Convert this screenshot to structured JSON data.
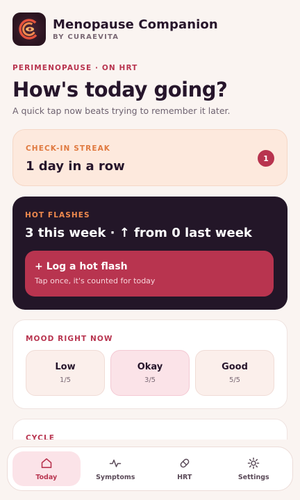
{
  "app": {
    "title": "Menopause Companion",
    "subtitle": "BY CURAEVITA"
  },
  "context": {
    "label": "PERIMENOPAUSE · ON HRT"
  },
  "greeting": {
    "title": "How's today going?",
    "subtitle": "A quick tap now beats trying to remember it later."
  },
  "streak": {
    "label": "CHECK-IN STREAK",
    "value": "1 day in a row",
    "badge": "1"
  },
  "hot_flashes": {
    "label": "HOT FLASHES",
    "summary": "3 this week · ↑ from 0 last week",
    "button_label": "+ Log a hot flash",
    "button_hint": "Tap once, it's counted for today"
  },
  "mood": {
    "label": "MOOD RIGHT NOW",
    "options": [
      {
        "name": "Low",
        "score": "1/5"
      },
      {
        "name": "Okay",
        "score": "3/5"
      },
      {
        "name": "Good",
        "score": "5/5"
      }
    ],
    "selected": "Okay"
  },
  "cycle": {
    "label": "CYCLE"
  },
  "nav": {
    "items": [
      {
        "label": "Today",
        "icon": "home-icon",
        "active": true
      },
      {
        "label": "Symptoms",
        "icon": "pulse-icon",
        "active": false
      },
      {
        "label": "HRT",
        "icon": "pill-icon",
        "active": false
      },
      {
        "label": "Settings",
        "icon": "gear-icon",
        "active": false
      }
    ]
  },
  "colors": {
    "accent": "#b8344f",
    "dark_card": "#231628",
    "streak_bg": "#fde9dd",
    "orange_label": "#e0793f",
    "page_bg": "#faf4f1"
  }
}
